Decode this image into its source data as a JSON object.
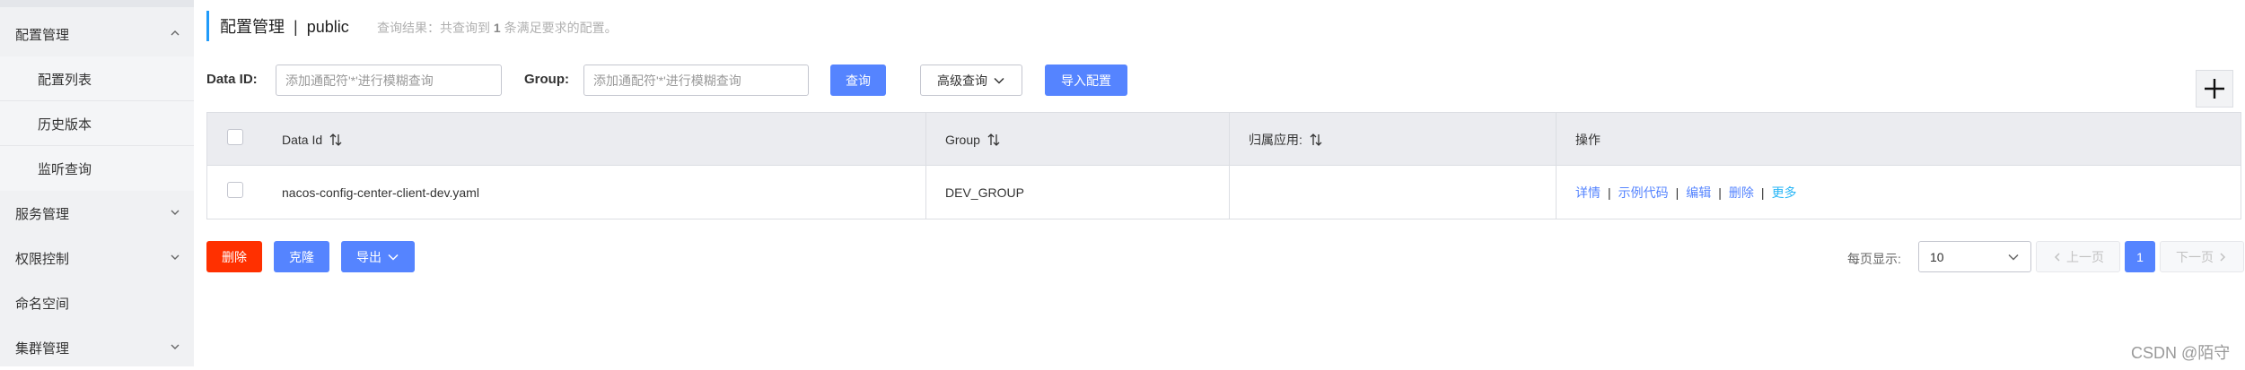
{
  "sidebar": {
    "items": [
      {
        "label": "配置管理"
      },
      {
        "label": "配置列表"
      },
      {
        "label": "历史版本"
      },
      {
        "label": "监听查询"
      },
      {
        "label": "服务管理"
      },
      {
        "label": "权限控制"
      },
      {
        "label": "命名空间"
      },
      {
        "label": "集群管理"
      }
    ]
  },
  "header": {
    "title": "配置管理",
    "separator": "|",
    "namespace": "public",
    "result_prefix": "查询结果：共查询到",
    "result_count": "1",
    "result_suffix": "条满足要求的配置。"
  },
  "filters": {
    "data_id_label": "Data ID:",
    "data_id_placeholder": "添加通配符'*'进行模糊查询",
    "group_label": "Group:",
    "group_placeholder": "添加通配符'*'进行模糊查询",
    "query_button": "查询",
    "advanced_button": "高级查询",
    "import_button": "导入配置"
  },
  "table": {
    "columns": [
      "Data Id",
      "Group",
      "归属应用:",
      "操作"
    ],
    "rows": [
      {
        "data_id": "nacos-config-center-client-dev.yaml",
        "group": "DEV_GROUP",
        "app": "",
        "ops": [
          "详情",
          "示例代码",
          "编辑",
          "删除",
          "更多"
        ]
      }
    ]
  },
  "actions": {
    "delete": "删除",
    "clone": "克隆",
    "export": "导出"
  },
  "pagination": {
    "page_size_label": "每页显示:",
    "page_size": "10",
    "prev": "上一页",
    "current": "1",
    "next": "下一页"
  },
  "watermark": "CSDN @陌守",
  "colors": {
    "primary": "#5584ff",
    "danger": "#ff3000",
    "accent_bar": "#209bfa",
    "sidebar_bg": "#f0f1f3"
  }
}
